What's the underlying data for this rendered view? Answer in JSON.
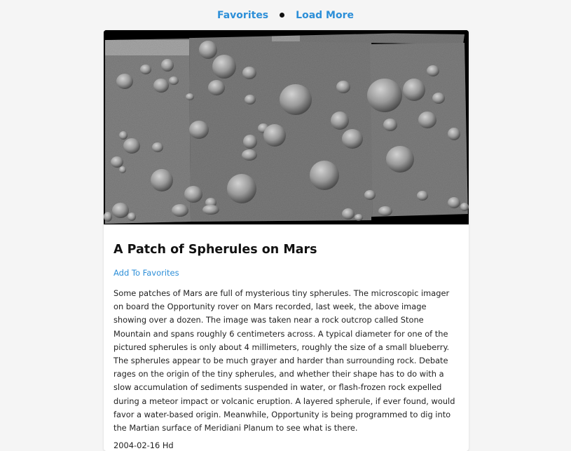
{
  "nav": {
    "favorites_label": "Favorites",
    "load_more_label": "Load More"
  },
  "article": {
    "image_alt": "A Patch of Spherules on Mars",
    "title": "A Patch of Spherules on Mars",
    "add_favorite_label": "Add To Favorites",
    "description": "Some patches of Mars are full of mysterious tiny spherules. The microscopic imager on board the Opportunity rover on Mars recorded, last week, the above image showing over a dozen. The image was taken near a rock outcrop called Stone Mountain and spans roughly 6 centimeters across. A typical diameter for one of the pictured spherules is only about 4 millimeters, roughly the size of a small blueberry. The spherules appear to be much grayer and harder than surrounding rock. Debate rages on the origin of the tiny spherules, and whether their shape has to do with a slow accumulation of sediments suspended in water, or flash-frozen rock expelled during a meteor impact or volcanic eruption. A layered spherule, if ever found, would favor a water-based origin. Meanwhile, Opportunity is being programmed to dig into the Martian surface of Meridiani Planum to see what is there.",
    "date": "2004-02-16 Hd"
  },
  "colors": {
    "link": "#2d8fd8",
    "background": "#f5f5f5",
    "card": "#ffffff"
  }
}
